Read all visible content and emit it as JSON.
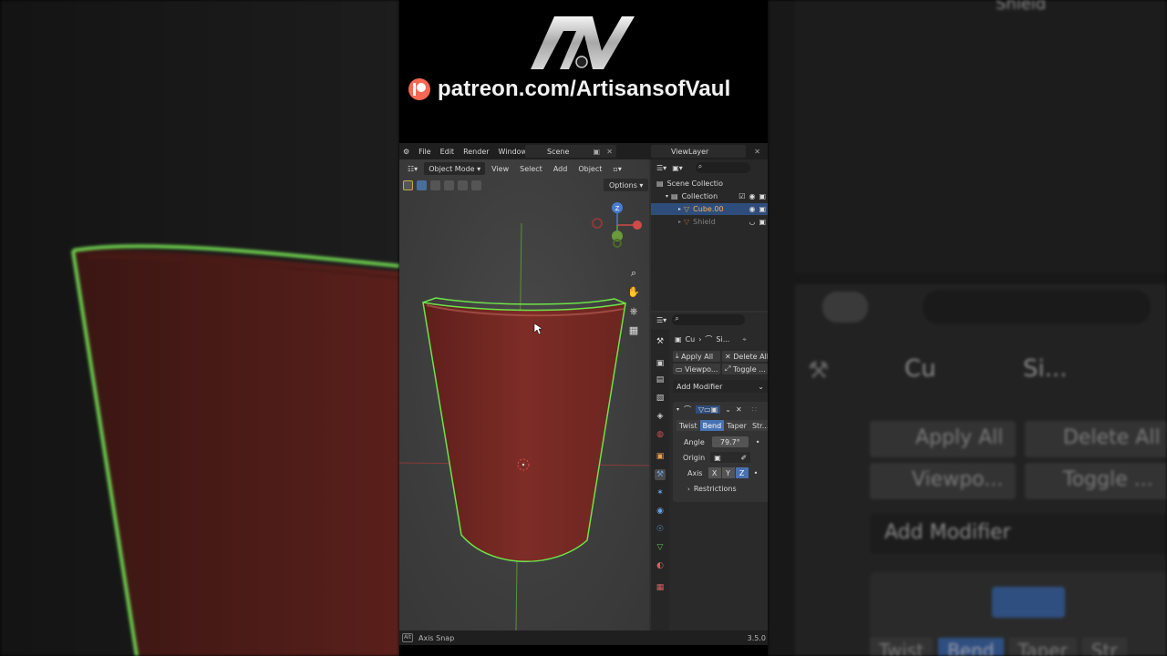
{
  "banner": {
    "logo_text": "AV",
    "url": "patreon.com/ArtisansofVaul"
  },
  "topbar": {
    "menus": [
      "File",
      "Edit",
      "Render",
      "Window"
    ],
    "scene": "Scene",
    "view_layer": "ViewLayer"
  },
  "viewport": {
    "mode": "Object Mode",
    "menus": [
      "View",
      "Select",
      "Add",
      "Object"
    ],
    "options_label": "Options",
    "gizmo_axis": "Z"
  },
  "outliner": {
    "rows": [
      {
        "label": "Scene Collectio"
      },
      {
        "label": "Collection"
      },
      {
        "label": "Cube.00"
      },
      {
        "label": "Shield"
      }
    ]
  },
  "properties": {
    "breadcrumb_obj": "Cu",
    "breadcrumb_mod": "Si...",
    "apply_all": "Apply All",
    "delete_all": "Delete All",
    "viewport_btn": "Viewpo...",
    "toggle_btn": "Toggle ...",
    "add_modifier": "Add Modifier",
    "mode_tabs": [
      "Twist",
      "Bend",
      "Taper",
      "Str..."
    ],
    "angle_label": "Angle",
    "angle_value": "79.7°",
    "origin_label": "Origin",
    "axis_label": "Axis",
    "axes": [
      "X",
      "Y",
      "Z"
    ],
    "restrictions": "Restrictions"
  },
  "status": {
    "key": "Alt",
    "hint": "Axis Snap",
    "version": "3.5.0"
  },
  "right_bg": {
    "obj_label": "Cu",
    "mod_label": "Si...",
    "apply_all": "Apply All",
    "delete_all": "Delete All",
    "viewport_btn": "Viewpo...",
    "toggle_btn": "Toggle ...",
    "add_modifier": "Add Modifier",
    "mode_tabs": [
      "Twist",
      "Bend",
      "Taper",
      "Str"
    ],
    "top_label": "Shield"
  },
  "colors": {
    "accent": "#4772b3",
    "selection_outline": "#5fd44a",
    "mesh_red": "#7a2a24",
    "patreon": "#f96854"
  }
}
